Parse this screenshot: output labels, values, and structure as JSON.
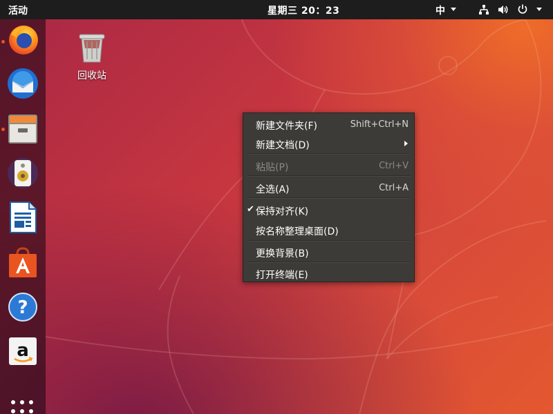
{
  "topbar": {
    "activities": "活动",
    "clock": "星期三 20：23",
    "input_method": "中",
    "icons": [
      "network-wired-icon",
      "volume-icon",
      "power-icon"
    ]
  },
  "dock": {
    "apps": [
      {
        "name": "firefox",
        "icon": "firefox-icon",
        "running": true
      },
      {
        "name": "thunderbird",
        "icon": "thunderbird-icon",
        "running": false
      },
      {
        "name": "files",
        "icon": "files-icon",
        "running": true
      },
      {
        "name": "rhythmbox",
        "icon": "rhythmbox-icon",
        "running": false
      },
      {
        "name": "libreoffice-writer",
        "icon": "writer-icon",
        "running": false
      },
      {
        "name": "ubuntu-software",
        "icon": "software-icon",
        "running": false
      },
      {
        "name": "help",
        "icon": "help-icon",
        "running": false
      },
      {
        "name": "amazon",
        "icon": "amazon-icon",
        "running": false
      }
    ],
    "show_apps_icon": "app-grid-icon"
  },
  "desktop": {
    "trash_label": "回收站"
  },
  "context_menu": {
    "new_folder": {
      "label": "新建文件夹(F)",
      "shortcut": "Shift+Ctrl+N"
    },
    "new_document": {
      "label": "新建文档(D)"
    },
    "paste": {
      "label": "粘贴(P)",
      "shortcut": "Ctrl+V",
      "enabled": false
    },
    "select_all": {
      "label": "全选(A)",
      "shortcut": "Ctrl+A"
    },
    "keep_aligned": {
      "label": "保持对齐(K)",
      "checked": true
    },
    "organize_by_name": {
      "label": "按名称整理桌面(D)"
    },
    "change_background": {
      "label": "更换背景(B)"
    },
    "open_terminal": {
      "label": "打开终端(E)"
    }
  },
  "colors": {
    "accent": "#e95420",
    "topbar": "#1d1d1d",
    "menu_bg": "#3c3b37"
  }
}
